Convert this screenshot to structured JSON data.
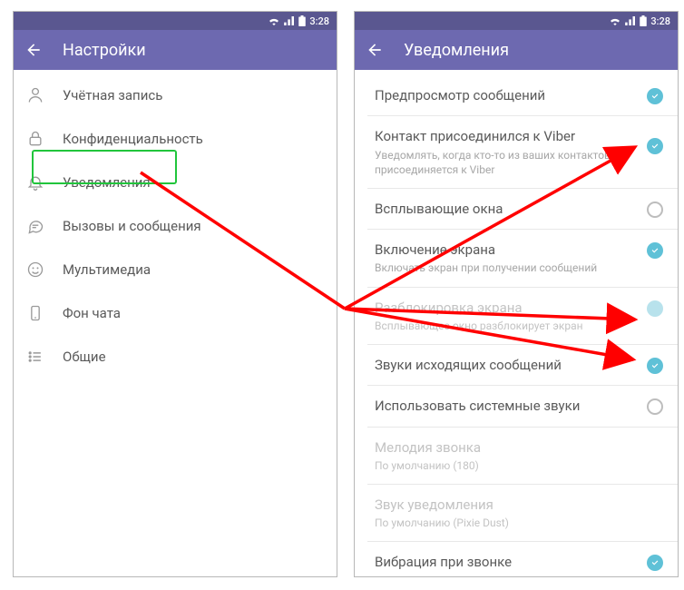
{
  "status": {
    "time": "3:28"
  },
  "left": {
    "title": "Настройки",
    "items": [
      {
        "label": "Учётная запись",
        "icon": "user"
      },
      {
        "label": "Конфиденциальность",
        "icon": "lock"
      },
      {
        "label": "Уведомления",
        "icon": "bell"
      },
      {
        "label": "Вызовы и сообщения",
        "icon": "chat"
      },
      {
        "label": "Мультимедиа",
        "icon": "media"
      },
      {
        "label": "Фон чата",
        "icon": "phone"
      },
      {
        "label": "Общие",
        "icon": "list"
      }
    ]
  },
  "right": {
    "title": "Уведомления",
    "rows": [
      {
        "title": "Предпросмотр сообщений",
        "sub": "",
        "ctrl": "check",
        "disabled": false
      },
      {
        "title": "Контакт присоединился к Viber",
        "sub": "Уведомлять, когда кто-то из ваших контактов присоединяется к Viber",
        "ctrl": "check",
        "disabled": false
      },
      {
        "title": "Всплывающие окна",
        "sub": "",
        "ctrl": "ring",
        "disabled": false
      },
      {
        "title": "Включение экрана",
        "sub": "Включать экран при получении сообщений",
        "ctrl": "check",
        "disabled": false
      },
      {
        "title": "Разблокировка экрана",
        "sub": "Всплывающее окно разблокирует экран",
        "ctrl": "checkdim",
        "disabled": true
      },
      {
        "title": "Звуки исходящих сообщений",
        "sub": "",
        "ctrl": "check",
        "disabled": false
      },
      {
        "title": "Использовать системные звуки",
        "sub": "",
        "ctrl": "ring",
        "disabled": false
      },
      {
        "title": "Мелодия звонка",
        "sub": "По умолчанию (180)",
        "ctrl": "",
        "disabled": true
      },
      {
        "title": "Звук уведомления",
        "sub": "По умолчанию (Pixie Dust)",
        "ctrl": "",
        "disabled": true
      },
      {
        "title": "Вибрация при звонке",
        "sub": "",
        "ctrl": "check",
        "disabled": false
      }
    ]
  }
}
